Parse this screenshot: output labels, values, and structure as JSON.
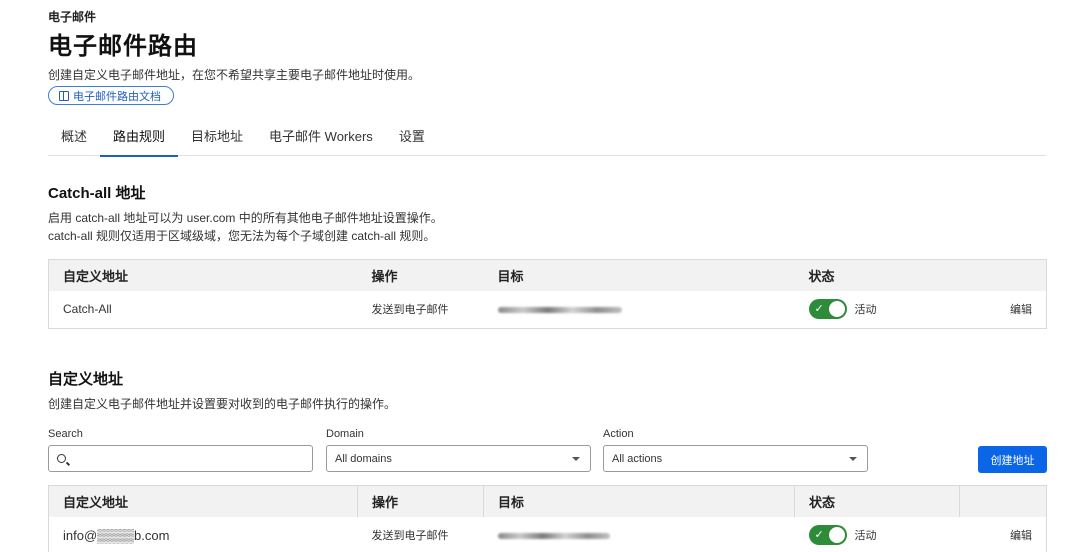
{
  "header": {
    "breadcrumb": "电子邮件",
    "title": "电子邮件路由",
    "description": "创建自定义电子邮件地址，在您不希望共享主要电子邮件地址时使用。",
    "doc_link": "电子邮件路由文档"
  },
  "tabs": [
    {
      "label": "概述",
      "active": false
    },
    {
      "label": "路由规则",
      "active": true
    },
    {
      "label": "目标地址",
      "active": false
    },
    {
      "label": "电子邮件 Workers",
      "active": false
    },
    {
      "label": "设置",
      "active": false
    }
  ],
  "catch_all": {
    "title": "Catch-all 地址",
    "desc_line1": "启用 catch-all 地址可以为 user.com 中的所有其他电子邮件地址设置操作。",
    "desc_line2": "catch-all 规则仅适用于区域级域，您无法为每个子域创建 catch-all 规则。",
    "columns": [
      "自定义地址",
      "操作",
      "目标",
      "状态"
    ],
    "row": {
      "address": "Catch-All",
      "action": "发送到电子邮件",
      "status": "活动",
      "edit": "编辑"
    }
  },
  "custom": {
    "title": "自定义地址",
    "desc": "创建自定义电子邮件地址并设置要对收到的电子邮件执行的操作。",
    "filters": {
      "search_label": "Search",
      "domain_label": "Domain",
      "domain_value": "All domains",
      "action_label": "Action",
      "action_value": "All actions"
    },
    "create_button": "创建地址",
    "columns": [
      "自定义地址",
      "操作",
      "目标",
      "状态"
    ],
    "row": {
      "address": "info@▒▒▒▒b.com",
      "action": "发送到电子邮件",
      "status": "活动",
      "edit": "编辑"
    }
  },
  "colors": {
    "accent": "#1f5fbf",
    "button": "#0a66e6",
    "toggle_on": "#2e8b3a"
  }
}
